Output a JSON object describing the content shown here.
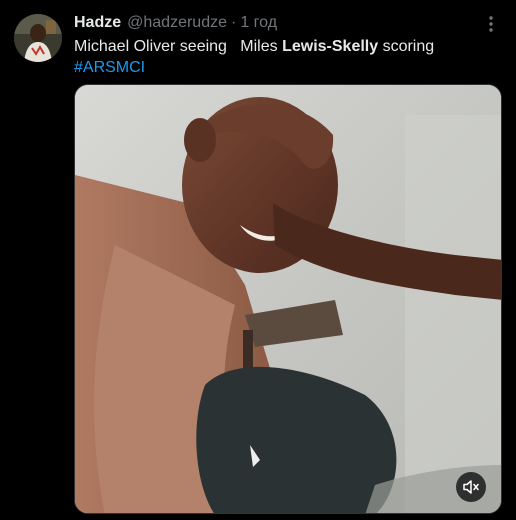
{
  "author": {
    "display_name": "Hadze",
    "handle": "@hadzerudze",
    "separator": "·",
    "timestamp": "1 год",
    "avatar_icon": "user-avatar-photo"
  },
  "tweet": {
    "text_part1": "Michael Oliver seeing   Miles ",
    "text_bold": "Lewis-Skelly",
    "text_part2": " scoring",
    "hashtag": "#ARSMCI"
  },
  "media": {
    "type": "video",
    "controls": {
      "mute_icon": "volume-muted-icon"
    }
  },
  "icons": {
    "more": "more-options-icon"
  },
  "colors": {
    "background": "#000000",
    "text": "#e7e9ea",
    "secondary": "#71767b",
    "link": "#1d9bf0"
  }
}
